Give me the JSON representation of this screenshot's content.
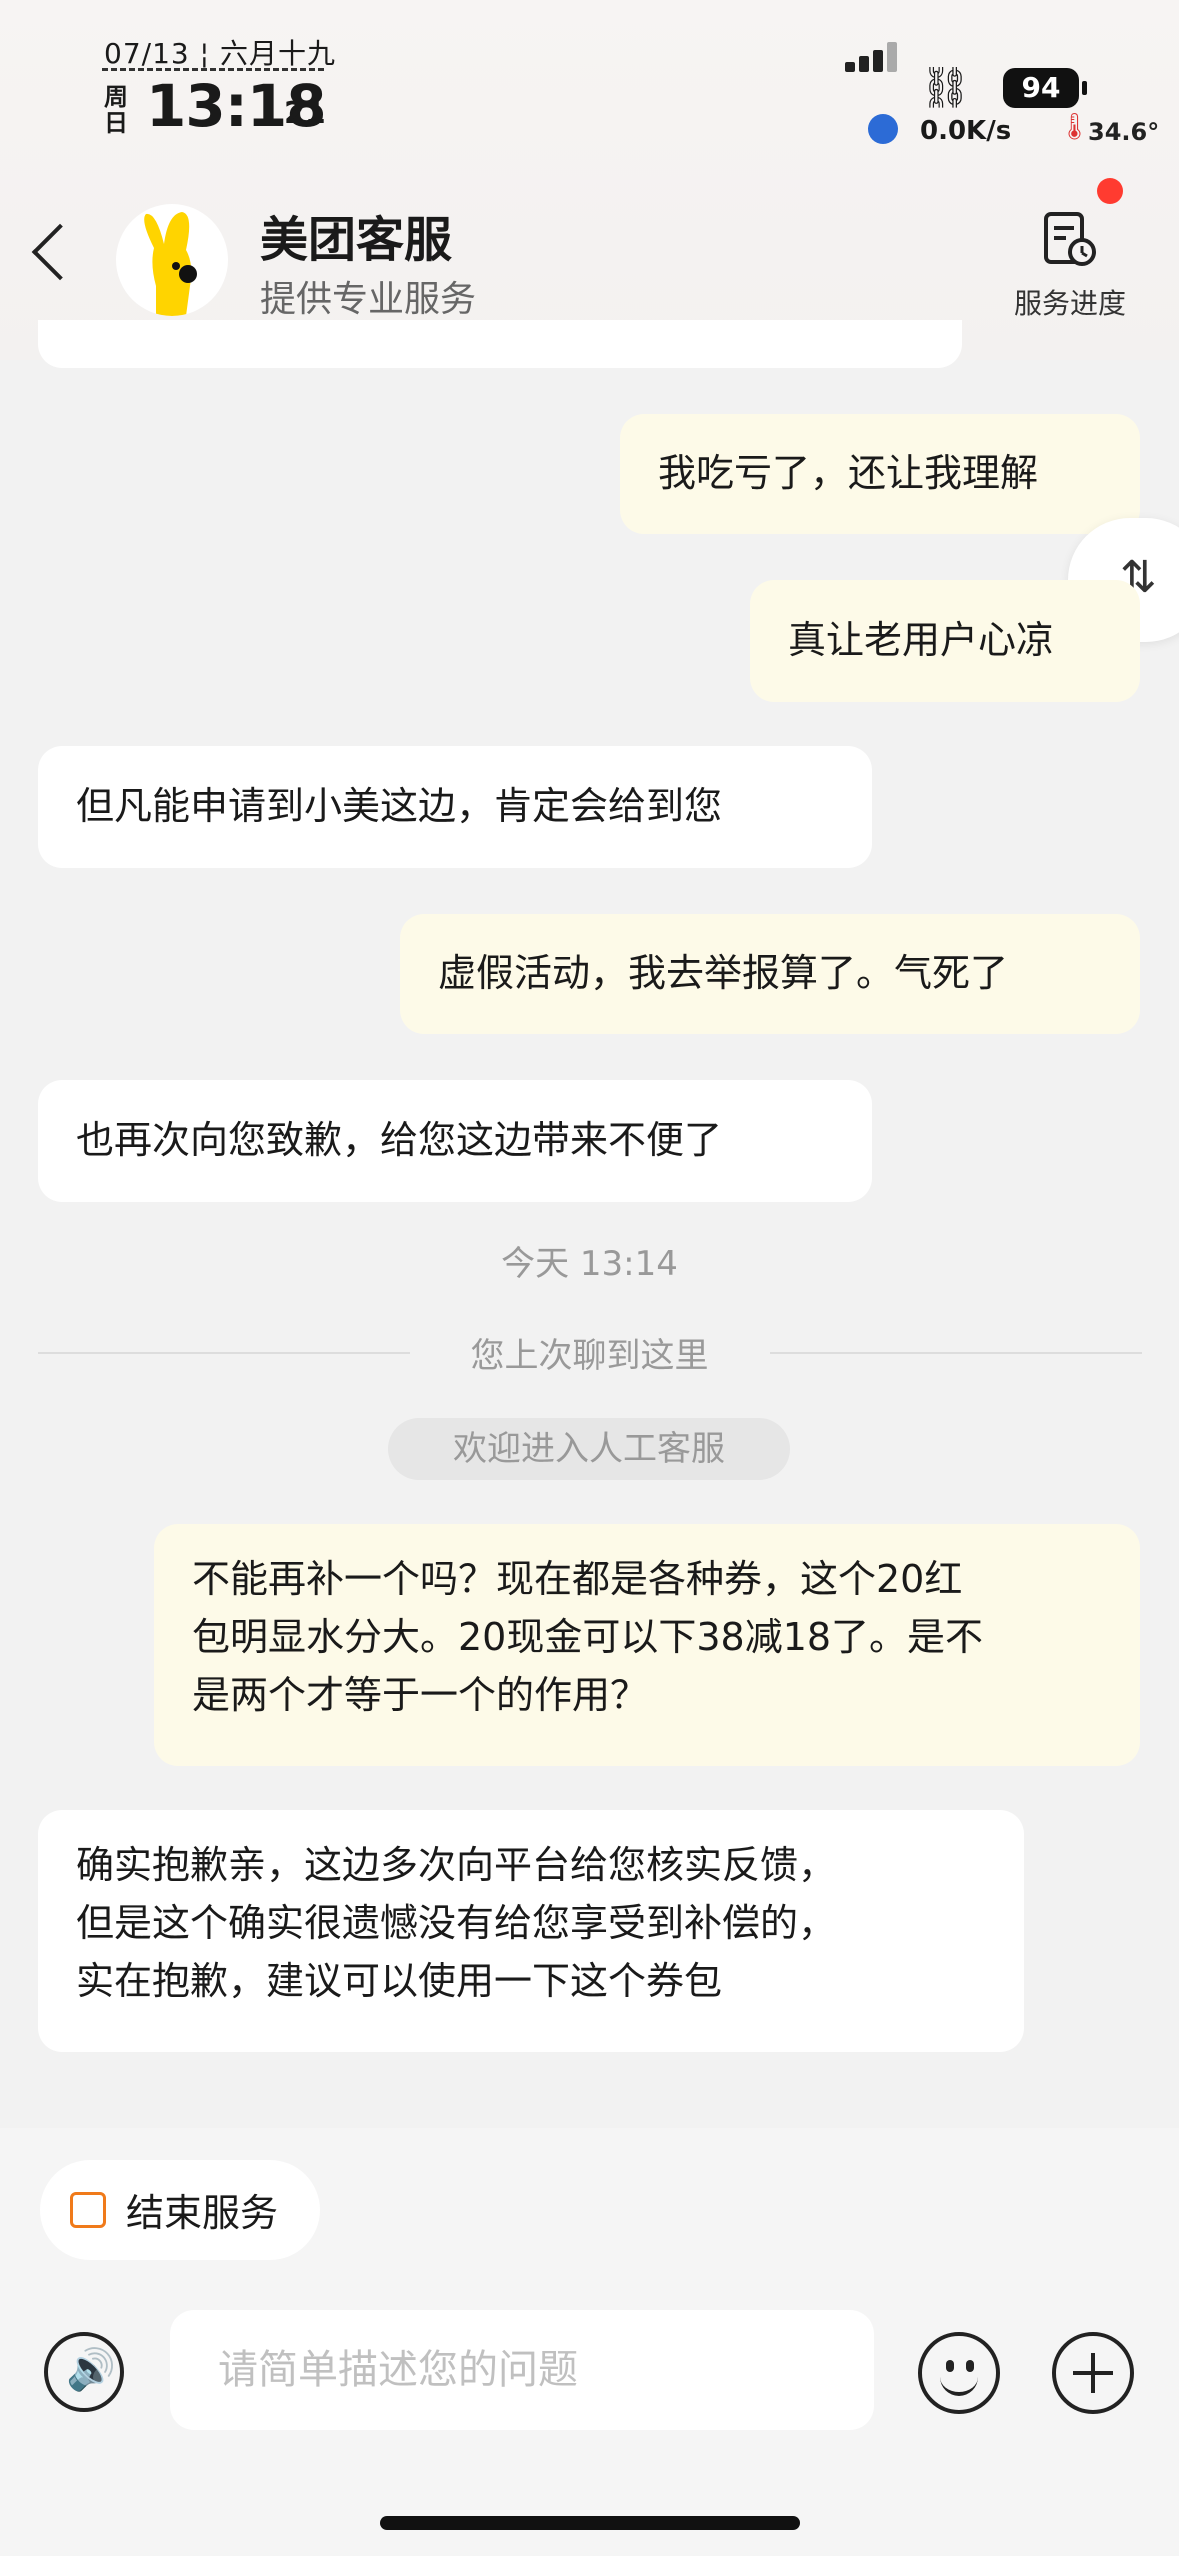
{
  "status_bar": {
    "date": "07/13",
    "lunar": "六月十九",
    "weekday": "周日",
    "time": "13:18",
    "seconds": "21",
    "battery": "94",
    "net_speed": "0.0K/s",
    "temperature": "34.6°"
  },
  "header": {
    "title": "美团客服",
    "subtitle": "提供专业服务",
    "progress_label": "服务进度"
  },
  "messages": [
    {
      "side": "out",
      "text": "我吃亏了，还让我理解"
    },
    {
      "side": "out",
      "text": "真让老用户心凉"
    },
    {
      "side": "in",
      "text": "但凡能申请到小美这边，肯定会给到您"
    },
    {
      "side": "out",
      "text": "虚假活动，我去举报算了。气死了"
    },
    {
      "side": "in",
      "text": "也再次向您致歉，给您这边带来不便了"
    }
  ],
  "divider": {
    "time": "今天 13:14",
    "history": "您上次聊到这里",
    "welcome": "欢迎进入人工客服"
  },
  "messages2": [
    {
      "side": "out",
      "lines": [
        "不能再补一个吗？现在都是各种券，这个20红",
        "包明显水分大。20现金可以下38减18了。是不",
        "是两个才等于一个的作用？"
      ]
    },
    {
      "side": "in",
      "lines": [
        "确实抱歉亲，这边多次向平台给您核实反馈，",
        "但是这个确实很遗憾没有给您享受到补偿的，",
        "实在抱歉，建议可以使用一下这个券包"
      ]
    }
  ],
  "bottom": {
    "end_service": "结束服务",
    "input_placeholder": "请简单描述您的问题"
  },
  "colors": {
    "outgoing_bubble": "#fdfae8",
    "incoming_bubble": "#ffffff",
    "accent_orange": "#f07a1a"
  },
  "icons": [
    "back-arrow-icon",
    "service-progress-icon",
    "scroll-toggle-icon",
    "end-service-icon",
    "voice-icon",
    "emoji-icon",
    "plus-icon"
  ]
}
